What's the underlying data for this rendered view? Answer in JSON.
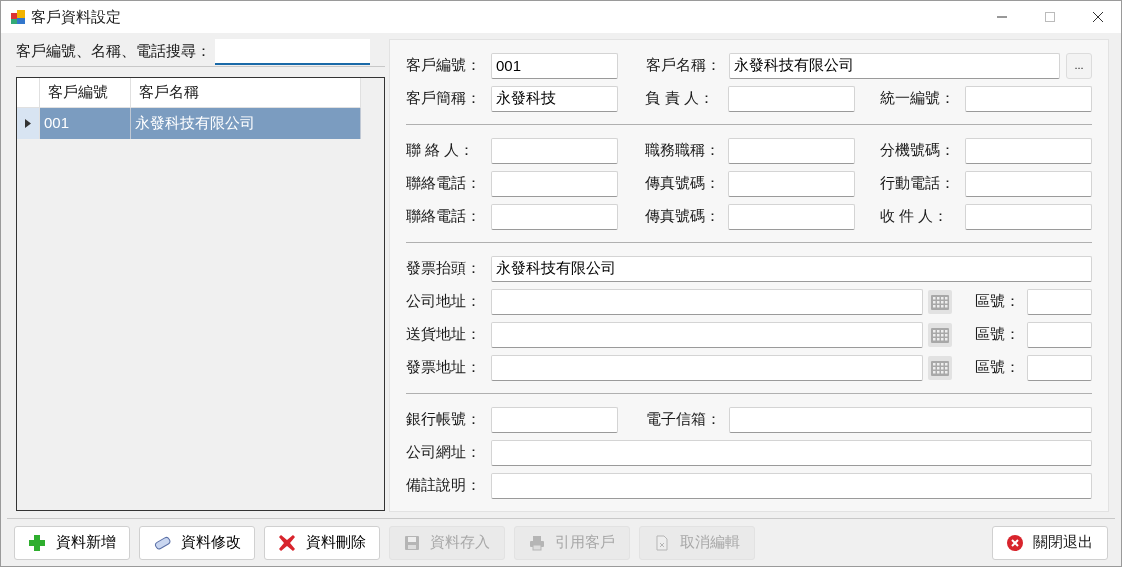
{
  "window": {
    "title": "客戶資料設定"
  },
  "search": {
    "label": "客戶編號、名稱、電話搜尋："
  },
  "grid": {
    "columns": [
      "客戶編號",
      "客戶名稱"
    ],
    "rows": [
      {
        "cells": [
          "001",
          "永發科技有限公司"
        ],
        "selected": true
      }
    ]
  },
  "sections": [
    {
      "rows": [
        {
          "kind": "name",
          "fields": [
            {
              "label": "客戶編號：",
              "value": "001"
            },
            {
              "label": "客戶名稱：",
              "value": "永發科技有限公司",
              "button": "..."
            }
          ]
        },
        {
          "kind": "triple",
          "fields": [
            {
              "label": "客戶簡稱：",
              "value": "永發科技"
            },
            {
              "label": "負 責 人："
            },
            {
              "label": "統一編號："
            }
          ]
        }
      ]
    },
    {
      "rows": [
        {
          "kind": "triple",
          "fields": [
            {
              "label": "聯 絡 人："
            },
            {
              "label": "職務職稱："
            },
            {
              "label": "分機號碼："
            }
          ]
        },
        {
          "kind": "triple",
          "fields": [
            {
              "label": "聯絡電話："
            },
            {
              "label": "傳真號碼："
            },
            {
              "label": "行動電話："
            }
          ]
        },
        {
          "kind": "triple",
          "fields": [
            {
              "label": "聯絡電話："
            },
            {
              "label": "傳真號碼："
            },
            {
              "label": "收 件 人："
            }
          ]
        }
      ]
    },
    {
      "rows": [
        {
          "kind": "full",
          "fields": [
            {
              "label": "發票抬頭：",
              "value": "永發科技有限公司"
            }
          ]
        },
        {
          "kind": "address",
          "fields": [
            {
              "label": "公司地址："
            },
            {
              "label": "區號："
            }
          ]
        },
        {
          "kind": "address",
          "fields": [
            {
              "label": "送貨地址："
            },
            {
              "label": "區號："
            }
          ]
        },
        {
          "kind": "address",
          "fields": [
            {
              "label": "發票地址："
            },
            {
              "label": "區號："
            }
          ]
        }
      ]
    },
    {
      "rows": [
        {
          "kind": "pair_wide",
          "fields": [
            {
              "label": "銀行帳號："
            },
            {
              "label": "電子信箱："
            }
          ]
        },
        {
          "kind": "full",
          "fields": [
            {
              "label": "公司網址："
            }
          ]
        },
        {
          "kind": "full",
          "fields": [
            {
              "label": "備註說明："
            }
          ]
        }
      ]
    }
  ],
  "buttons": [
    {
      "label": "資料新增",
      "kind": "add",
      "disabled": false
    },
    {
      "label": "資料修改",
      "kind": "edit",
      "disabled": false
    },
    {
      "label": "資料刪除",
      "kind": "delete",
      "disabled": false
    },
    {
      "label": "資料存入",
      "kind": "save",
      "disabled": true
    },
    {
      "label": "引用客戶",
      "kind": "import",
      "disabled": true
    },
    {
      "label": "取消編輯",
      "kind": "cancel",
      "disabled": true
    }
  ],
  "close_button": {
    "label": "關閉退出"
  }
}
